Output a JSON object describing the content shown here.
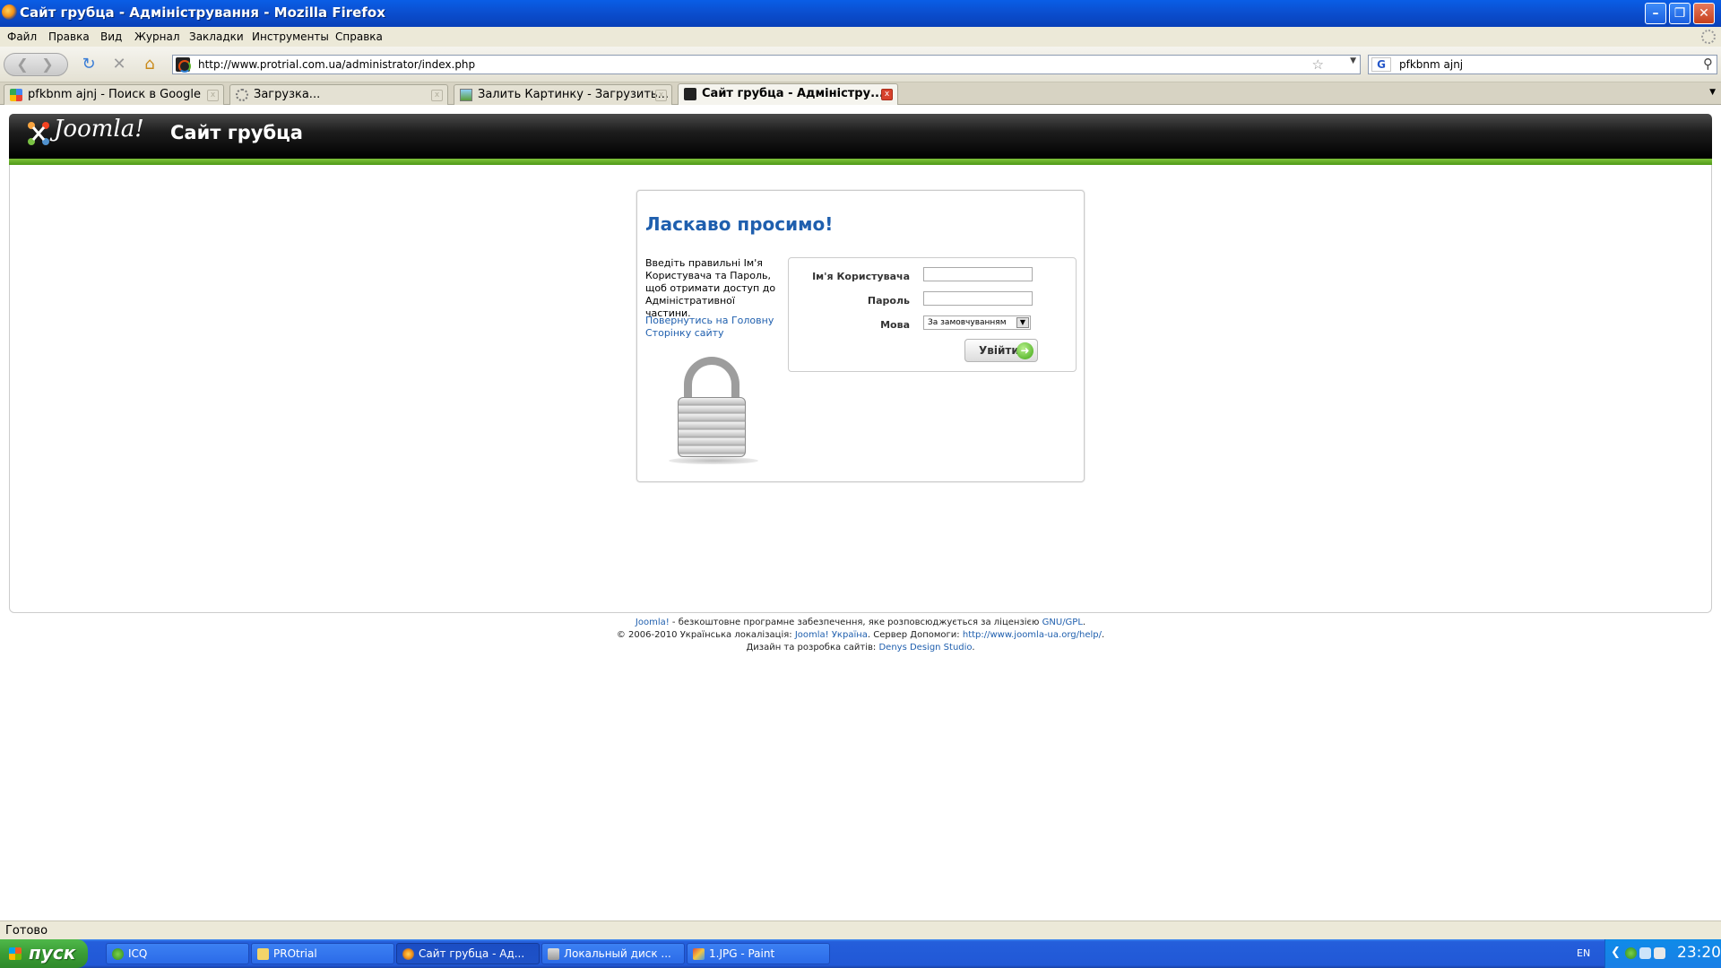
{
  "window": {
    "title": "Сайт грубца - Адміністрування - Mozilla Firefox",
    "minimize": "–",
    "maximize": "❐",
    "close": "✕"
  },
  "menu": [
    "Файл",
    "Правка",
    "Вид",
    "Журнал",
    "Закладки",
    "Инструменты",
    "Справка"
  ],
  "nav": {
    "url": "http://www.protrial.com.ua/administrator/index.php",
    "search_value": "pfkbnm ajnj",
    "search_engine_icon": "G"
  },
  "tabs": [
    {
      "label": "pfkbnm ajnj - Поиск в Google",
      "icon": "google-icon"
    },
    {
      "label": "Загрузка...",
      "icon": "loading-icon"
    },
    {
      "label": "Залить Картинку - Загрузить...",
      "icon": "image-icon"
    },
    {
      "label": "Сайт грубца - Адміністру...",
      "icon": "joomla-icon"
    }
  ],
  "header": {
    "logo_text": "Joomla!",
    "site_name": "Сайт грубца"
  },
  "login": {
    "heading": "Ласкаво просимо!",
    "instructions": "Введіть правильні Ім'я Користувача та Пароль, щоб отримати доступ до Адміністративної частини.",
    "back_link": "Повернутись на Головну Сторінку сайту",
    "username_label": "Ім'я Користувача",
    "password_label": "Пароль",
    "language_label": "Мова",
    "language_value": "За замовчуванням",
    "submit_label": "Увійти"
  },
  "footer": {
    "line1_link": "Joomla!",
    "line1_text": " - безкоштовне програмне забезпечення, яке розповсюджується за ліцензією ",
    "line1_license": "GNU/GPL",
    "line1_end": ".",
    "line2_text": "© 2006-2010 Українська локалізація: ",
    "line2_link1": "Joomla! Україна",
    "line2_mid": ". Сервер Допомоги: ",
    "line2_link2": "http://www.joomla-ua.org/help/",
    "line2_end": ".",
    "line3_text": "Дизайн та розробка сайтів: ",
    "line3_link": "Denys Design Studio",
    "line3_end": "."
  },
  "status": "Готово",
  "taskbar": {
    "start_label": "пуск",
    "items": [
      {
        "label": "ICQ"
      },
      {
        "label": "PROtrial"
      },
      {
        "label": "Сайт грубца - Ад..."
      },
      {
        "label": "Локальный диск ..."
      },
      {
        "label": "1.JPG - Paint"
      }
    ],
    "lang": "EN",
    "clock": "23:20"
  }
}
